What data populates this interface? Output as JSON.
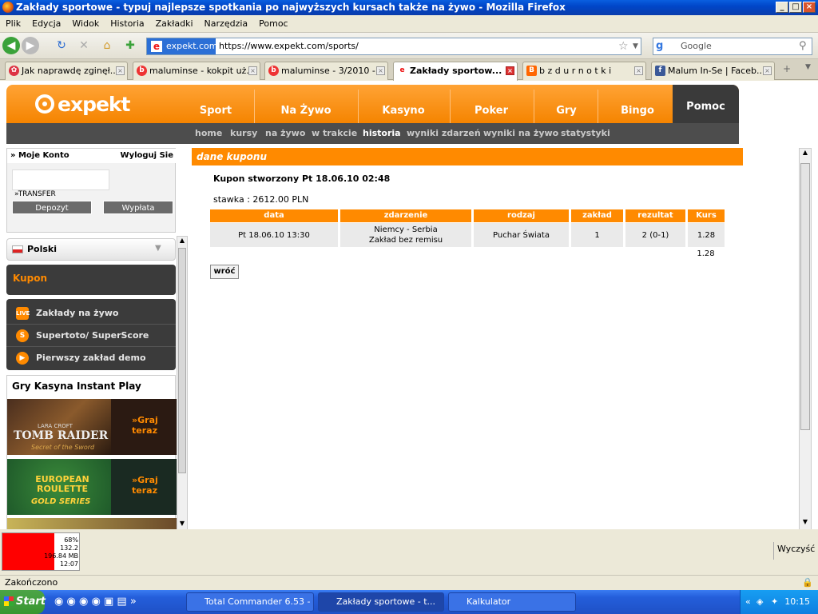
{
  "window": {
    "title": "Zakłady sportowe - typuj najlepsze spotkania po najwyższych kursach także na żywo - Mozilla Firefox"
  },
  "menu": [
    "Plik",
    "Edycja",
    "Widok",
    "Historia",
    "Zakładki",
    "Narzędzia",
    "Pomoc"
  ],
  "address": {
    "site": "expekt.com",
    "url": "https://www.expekt.com/sports/",
    "search_placeholder": "Google"
  },
  "tabs": [
    {
      "label": "Jak naprawdę zginęł...",
      "icon": "grid-icon",
      "color": "#d33"
    },
    {
      "label": "maluminse - kokpit uż...",
      "icon": "blog-b-icon",
      "color": "#e33"
    },
    {
      "label": "maluminse - 3/2010 -...",
      "icon": "blog-b-icon",
      "color": "#e33"
    },
    {
      "label": "Zakłady sportow...",
      "icon": "expekt-e-icon",
      "color": "#e11",
      "active": true
    },
    {
      "label": "b z d u r n o t k i",
      "icon": "blogger-icon",
      "color": "#f60"
    },
    {
      "label": "Malum In-Se | Faceb...",
      "icon": "facebook-icon",
      "color": "#3b5998"
    }
  ],
  "site": {
    "logo": "expekt",
    "nav": [
      "Sport",
      "Na Żywo",
      "Kasyno",
      "Poker",
      "Gry",
      "Bingo",
      "Pomoc"
    ],
    "subnav": [
      "home",
      "kursy",
      "na żywo",
      "w trakcie",
      "historia",
      "wyniki zdarzeń",
      "wyniki na żywo",
      "statystyki"
    ],
    "subnav_active": "historia"
  },
  "sidebar": {
    "account_title": "Moje Konto",
    "logout": "Wyloguj Sie",
    "transfer": "TRANSFER",
    "deposit": "Depozyt",
    "withdraw": "Wypłata",
    "language": "Polski",
    "kupon": "Kupon",
    "links": [
      {
        "label": "Zakłady na żywo",
        "icon": "live-icon"
      },
      {
        "label": "Supertoto/ SuperScore",
        "icon": "s-badge-icon"
      },
      {
        "label": "Pierwszy zakład demo",
        "icon": "play-icon"
      }
    ],
    "games_title": "Gry Kasyna Instant Play",
    "games": [
      {
        "title": "TOMB RAIDER",
        "subtitle": "Secret of the Sword",
        "cta": "Graj teraz",
        "logo_top": "LARA CROFT"
      },
      {
        "title": "EUROPEAN ROULETTE",
        "subtitle": "GOLD SERIES",
        "cta": "Graj teraz"
      }
    ]
  },
  "main": {
    "header": "dane kuponu",
    "coupon_title": "Kupon stworzony Pt 18.06.10 02:48",
    "stake": "stawka : 2612.00 PLN",
    "columns": [
      "data",
      "zdarzenie",
      "rodzaj",
      "zakład",
      "rezultat",
      "Kurs"
    ],
    "row": {
      "data": "Pt 18.06.10 13:30",
      "event1": "Niemcy - Serbia",
      "event2": "Zakład bez remisu",
      "rodzaj": "Puchar Świata",
      "zaklad": "1",
      "rezultat": "2 (0-1)",
      "kurs": "1.28"
    },
    "total": "1.28",
    "back": "wróć"
  },
  "monitor": {
    "cpu": "68%",
    "l1": "132.2",
    "l2": "196.84 MB",
    "time": "12:07",
    "cpu_fraction": 0.68
  },
  "clear": "Wyczyść",
  "status": "Zakończono",
  "taskbar": {
    "start": "Start",
    "tasks": [
      "Total Commander 6.53 - ...",
      "Zakłady sportowe - t...",
      "Kalkulator"
    ],
    "clock": "10:15"
  }
}
